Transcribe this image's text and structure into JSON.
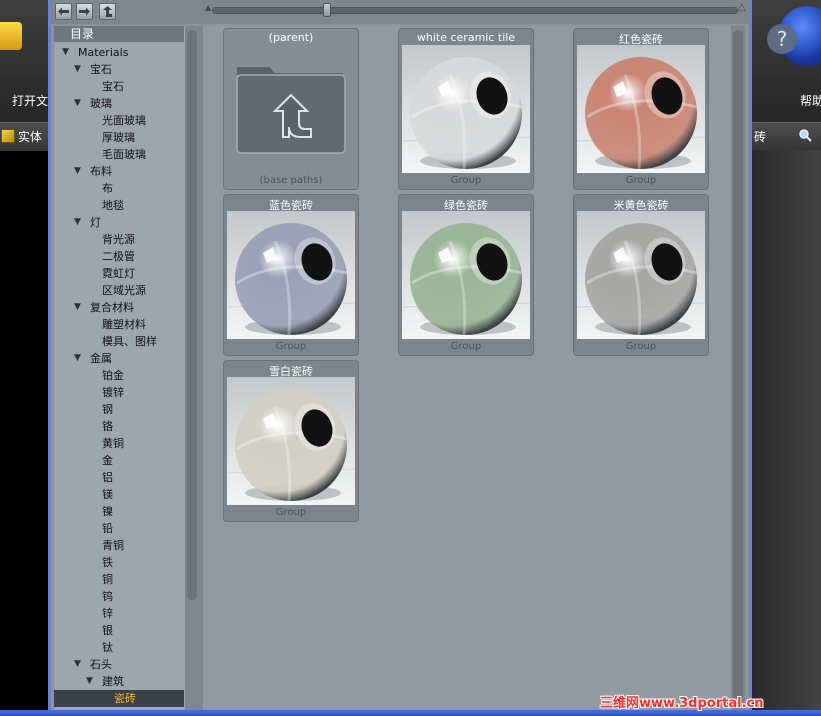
{
  "background_app": {
    "left_label": "打开文",
    "left_bar_label": "实体",
    "right_label": "帮助",
    "right_bar_label": "砖",
    "help_glyph": "?"
  },
  "toolbar": {
    "back_icon": "arrow-left-icon",
    "forward_icon": "arrow-right-icon",
    "up_icon": "up-icon",
    "zoom_level": 0.22
  },
  "tree": {
    "header": "目录",
    "rows": [
      {
        "label": "Materials",
        "level": 0,
        "expander": true
      },
      {
        "label": "宝石",
        "level": 1,
        "expander": true
      },
      {
        "label": "宝石",
        "level": 2
      },
      {
        "label": "玻璃",
        "level": 1,
        "expander": true
      },
      {
        "label": "光面玻璃",
        "level": 2
      },
      {
        "label": "厚玻璃",
        "level": 2
      },
      {
        "label": "毛面玻璃",
        "level": 2
      },
      {
        "label": "布料",
        "level": 1,
        "expander": true
      },
      {
        "label": "布",
        "level": 2
      },
      {
        "label": "地毯",
        "level": 2
      },
      {
        "label": "灯",
        "level": 1,
        "expander": true
      },
      {
        "label": "背光源",
        "level": 2
      },
      {
        "label": "二极管",
        "level": 2
      },
      {
        "label": "霓虹灯",
        "level": 2
      },
      {
        "label": "区域光源",
        "level": 2
      },
      {
        "label": "复合材料",
        "level": 1,
        "expander": true
      },
      {
        "label": "雕塑材料",
        "level": 2
      },
      {
        "label": "模具、图样",
        "level": 2
      },
      {
        "label": "金属",
        "level": 1,
        "expander": true
      },
      {
        "label": "铂金",
        "level": 2
      },
      {
        "label": "镀锌",
        "level": 2
      },
      {
        "label": "钢",
        "level": 2
      },
      {
        "label": "铬",
        "level": 2
      },
      {
        "label": "黄铜",
        "level": 2
      },
      {
        "label": "金",
        "level": 2
      },
      {
        "label": "铝",
        "level": 2
      },
      {
        "label": "镁",
        "level": 2
      },
      {
        "label": "镍",
        "level": 2
      },
      {
        "label": "铅",
        "level": 2
      },
      {
        "label": "青铜",
        "level": 2
      },
      {
        "label": "铁",
        "level": 2
      },
      {
        "label": "铜",
        "level": 2
      },
      {
        "label": "钨",
        "level": 2
      },
      {
        "label": "锌",
        "level": 2
      },
      {
        "label": "银",
        "level": 2
      },
      {
        "label": "钛",
        "level": 2
      },
      {
        "label": "石头",
        "level": 1,
        "expander": true
      },
      {
        "label": "建筑",
        "level": 2,
        "expander": true
      },
      {
        "label": "瓷砖",
        "level": 3,
        "selected": true
      }
    ]
  },
  "tiles": [
    {
      "title": "(parent)",
      "subtitle": "(base paths)",
      "kind": "parent-folder-icon"
    },
    {
      "title": "white ceramic tile",
      "subtitle": "Group",
      "color": "#d7d9da",
      "kind": "material-sphere"
    },
    {
      "title": "红色瓷砖",
      "subtitle": "Group",
      "color": "#c98474",
      "kind": "material-sphere"
    },
    {
      "title": "蓝色瓷砖",
      "subtitle": "Group",
      "color": "#9aa0b6",
      "kind": "material-sphere"
    },
    {
      "title": "绿色瓷砖",
      "subtitle": "Group",
      "color": "#9ab597",
      "kind": "material-sphere"
    },
    {
      "title": "米黄色瓷砖",
      "subtitle": "Group",
      "color": "#a6a6a4",
      "kind": "material-sphere"
    },
    {
      "title": "雪白瓷砖",
      "subtitle": "Group",
      "color": "#d2cfc3",
      "kind": "material-sphere"
    }
  ],
  "watermark": "三维网www.3dportal.cn"
}
